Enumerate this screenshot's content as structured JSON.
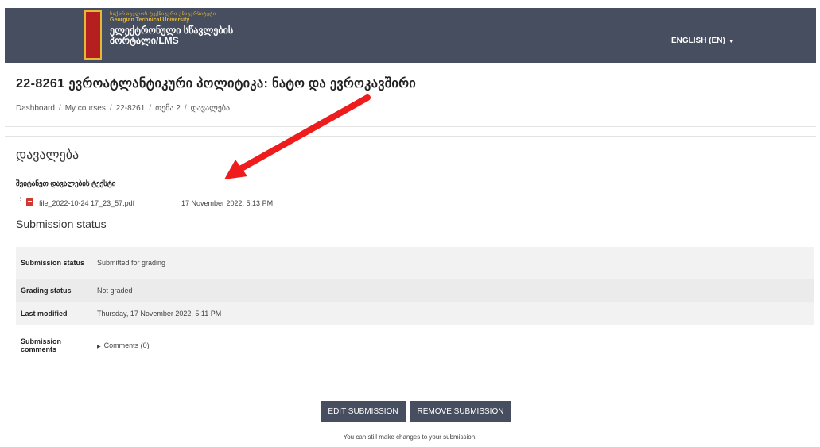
{
  "header": {
    "logo_line1": "საქართველოს ტექნიკური უნივერსიტეტი",
    "logo_line2": "Georgian Technical University",
    "logo_line3": "ელექტრონული სწავლების პორტალი/LMS",
    "language": "ENGLISH (EN)",
    "colors": {
      "bar": "#464e5f",
      "logo_accent": "#e3b93a",
      "logo_bg": "#b51f1f"
    }
  },
  "course": {
    "title": "22-8261 ევროატლანტიკური პოლიტიკა: ნატო და ევროკავშირი"
  },
  "breadcrumb": {
    "items": [
      "Dashboard",
      "My courses",
      "22-8261",
      "თემა 2",
      "დავალება"
    ]
  },
  "activity": {
    "title": "დავალება",
    "description_heading": "შეიტანეთ დავალების ტექსტი",
    "file": {
      "name": "file_2022-10-24 17_23_57.pdf",
      "date": "17 November 2022, 5:13 PM",
      "icon": "pdf-icon"
    }
  },
  "submission": {
    "heading": "Submission status",
    "rows": [
      {
        "label": "Submission status",
        "value": "Submitted for grading"
      },
      {
        "label": "Grading status",
        "value": "Not graded"
      },
      {
        "label": "Last modified",
        "value": "Thursday, 17 November 2022, 5:11 PM"
      },
      {
        "label": "Submission comments",
        "value": "Comments (0)"
      }
    ],
    "edit_button": "EDIT SUBMISSION",
    "remove_button": "REMOVE SUBMISSION",
    "note": "You can still make changes to your submission."
  },
  "annotation": {
    "arrow_color": "#ee1c1c"
  }
}
